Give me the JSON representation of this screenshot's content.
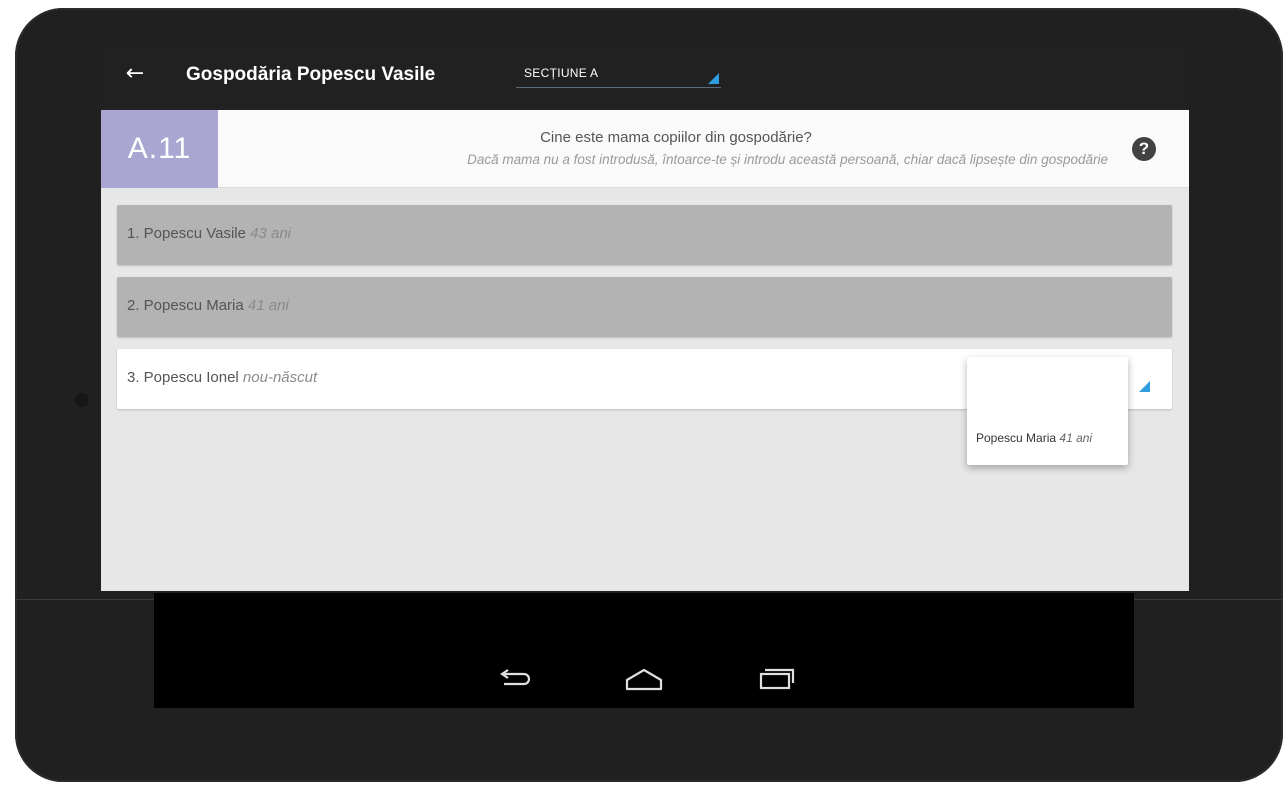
{
  "appbar": {
    "title": "Gospodăria Popescu Vasile",
    "section_select": "SECȚIUNE A"
  },
  "question": {
    "code": "A.11",
    "text": "Cine este mama copiilor din gospodărie?",
    "hint": "Dacă mama nu a fost introdusă, întoarce-te și introdu această persoană, chiar dacă lipsește din gospodărie"
  },
  "options": [
    {
      "name": "1. Popescu Vasile",
      "age": "43 ani",
      "selected": false
    },
    {
      "name": "2. Popescu Maria",
      "age": "41 ani",
      "selected": false
    },
    {
      "name": "3. Popescu Ionel",
      "age": "nou-născut",
      "selected": true
    }
  ],
  "dropdown": {
    "options": [
      {
        "name": "Popescu Maria",
        "age": "41 ani"
      }
    ]
  },
  "colors": {
    "accent": "#2f9de0",
    "question_code_bg": "#a9a7d2",
    "appbar_bg": "#212121",
    "option_bg": "#b3b3b3"
  },
  "icons": {
    "back": "arrow-left-icon",
    "help": "question-circle-icon",
    "nav_back": "back-icon",
    "nav_home": "home-icon",
    "nav_recents": "recents-icon"
  }
}
